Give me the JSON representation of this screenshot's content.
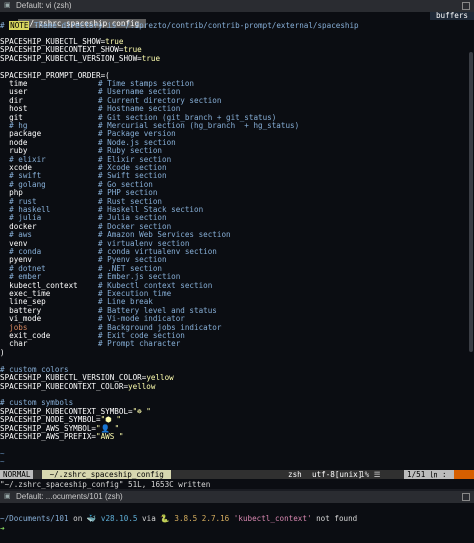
{
  "window1": {
    "title": "Default: vi (zsh)"
  },
  "tabline": {
    "active_tab": " ~/.zshrc_spaceship_config ",
    "buffers_label": "buffers"
  },
  "editor": {
    "line1_prefix": "# ",
    "line1_note": "NOTE",
    "line1_rest": " Theme directory is ~/.zprezto/contrib/contrib-prompt/external/spaceship",
    "kubectl_show": "SPACESHIP_KUBECTL_SHOW=",
    "kubectl_show_val": "true",
    "kubecontext_show": "SPACESHIP_KUBECONTEXT_SHOW=",
    "kubecontext_show_val": "true",
    "kubectl_version_show": "SPACESHIP_KUBECTL_VERSION_SHOW=",
    "kubectl_version_show_val": "true",
    "prompt_order": "SPACESHIP_PROMPT_ORDER=(",
    "order": [
      {
        "k": "  time",
        "c": "# Time stamps section"
      },
      {
        "k": "  user",
        "c": "# Username section"
      },
      {
        "k": "  dir",
        "c": "# Current directory section"
      },
      {
        "k": "  host",
        "c": "# Hostname section"
      },
      {
        "k": "  git",
        "c": "# Git section (git_branch + git_status)"
      },
      {
        "k": "  # hg",
        "c": "# Mercurial section (hg_branch  + hg_status)"
      },
      {
        "k": "  package",
        "c": "# Package version"
      },
      {
        "k": "  node",
        "c": "# Node.js section"
      },
      {
        "k": "  ruby",
        "c": "# Ruby section"
      },
      {
        "k": "  # elixir",
        "c": "# Elixir section"
      },
      {
        "k": "  xcode",
        "c": "# Xcode section"
      },
      {
        "k": "  # swift",
        "c": "# Swift section"
      },
      {
        "k": "  # golang",
        "c": "# Go section"
      },
      {
        "k": "  php",
        "c": "# PHP section"
      },
      {
        "k": "  # rust",
        "c": "# Rust section"
      },
      {
        "k": "  # haskell",
        "c": "# Haskell Stack section"
      },
      {
        "k": "  # julia",
        "c": "# Julia section"
      },
      {
        "k": "  docker",
        "c": "# Docker section"
      },
      {
        "k": "  # aws",
        "c": "# Amazon Web Services section"
      },
      {
        "k": "  venv",
        "c": "# virtualenv section"
      },
      {
        "k": "  # conda",
        "c": "# conda virtualenv section"
      },
      {
        "k": "  pyenv",
        "c": "# Pyenv section"
      },
      {
        "k": "  # dotnet",
        "c": "# .NET section"
      },
      {
        "k": "  # ember",
        "c": "# Ember.js section"
      },
      {
        "k": "  kubectl_context",
        "c": "# Kubectl context section"
      },
      {
        "k": "  exec_time",
        "c": "# Execution time"
      },
      {
        "k": "  line_sep",
        "c": "# Line break"
      },
      {
        "k": "  battery",
        "c": "# Battery level and status"
      },
      {
        "k": "  vi_mode",
        "c": "# Vi-mode indicator"
      },
      {
        "k": "  jobs",
        "c": "# Background jobs indicator"
      },
      {
        "k": "  exit_code",
        "c": "# Exit code section"
      },
      {
        "k": "  char",
        "c": "# Prompt character"
      }
    ],
    "close_paren": ")",
    "custom_colors_comment": "# custom colors",
    "kubectl_version_color": "SPACESHIP_KUBECTL_VERSION_COLOR=",
    "kubectl_version_color_val": "yellow",
    "kubecontext_color": "SPACESHIP_KUBECONTEXT_COLOR=",
    "kubecontext_color_val": "yellow",
    "custom_symbols_comment": "# custom symbols",
    "sym_kubecontext": "SPACESHIP_KUBECONTEXT_SYMBOL=",
    "sym_kubecontext_val": "\"☸ \"",
    "sym_node": "SPACESHIP_NODE_SYMBOL=",
    "sym_node_val": "\"⬢ \"",
    "sym_aws": "SPACESHIP_AWS_SYMBOL=",
    "sym_aws_val": "\"👤 \"",
    "sym_aws_prefix": "SPACESHIP_AWS_PREFIX=",
    "sym_aws_prefix_val": "\"AWS \"",
    "tilde": "~"
  },
  "statusline": {
    "mode": "NORMAL",
    "file": " ~/.zshrc_spaceship_config ",
    "filetype": "zsh",
    "encoding": "utf-8[unix]",
    "percent": "1% ☰",
    "position": "1/51 ㏑ :  1"
  },
  "cmdline": {
    "text": "\"~/.zshrc_spaceship_config\" 51L, 1653C written"
  },
  "window2": {
    "title": "Default: ...ocuments/101 (zsh)"
  },
  "prompt": {
    "path": "~/Documents/101",
    "on": " on ",
    "docker": "🐳 v28.10.5",
    "via": " via ",
    "python": "🐍 3.8.5 2.7.16",
    "k8s": " 'kubectl_context'",
    "not_found": " not found",
    "arrow": "➜"
  }
}
